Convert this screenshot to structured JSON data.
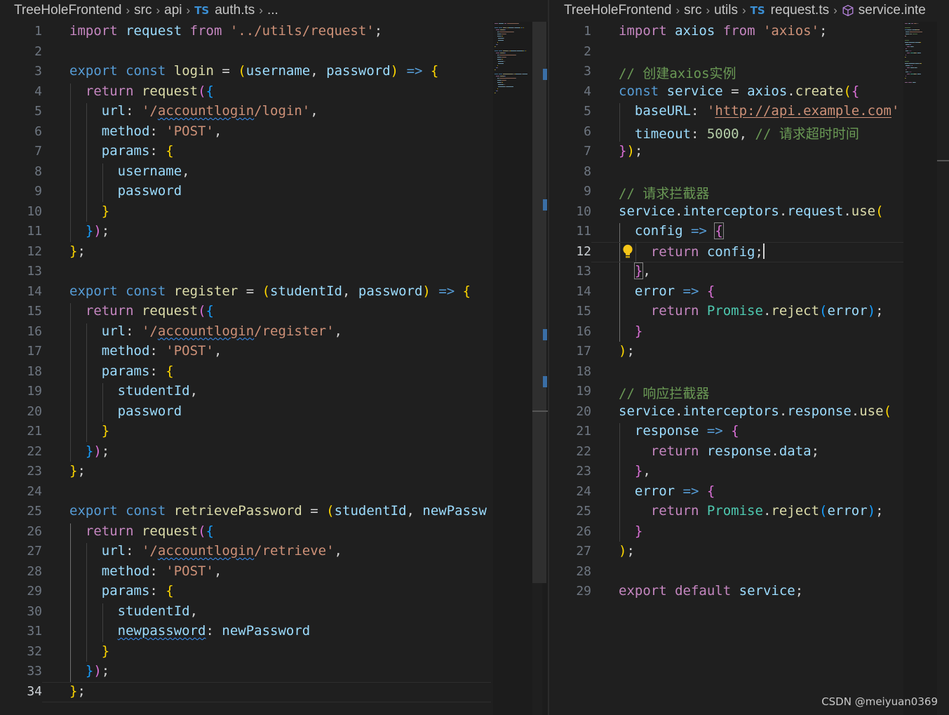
{
  "left_editor": {
    "breadcrumb": [
      "TreeHoleFrontend",
      "src",
      "api",
      "auth.ts",
      "..."
    ],
    "file_type_badge": "TS",
    "current_line": 34,
    "lines": [
      [
        [
          "kc",
          "import"
        ],
        [
          "op",
          " "
        ],
        [
          "vr",
          "request"
        ],
        [
          "op",
          " "
        ],
        [
          "kc",
          "from"
        ],
        [
          "op",
          " "
        ],
        [
          "st",
          "'../utils/request'"
        ],
        [
          "op",
          ";"
        ]
      ],
      [],
      [
        [
          "kw",
          "export"
        ],
        [
          "op",
          " "
        ],
        [
          "kw",
          "const"
        ],
        [
          "op",
          " "
        ],
        [
          "fn",
          "login"
        ],
        [
          "op",
          " = "
        ],
        [
          "b1",
          "("
        ],
        [
          "vr",
          "username"
        ],
        [
          "op",
          ", "
        ],
        [
          "vr",
          "password"
        ],
        [
          "b1",
          ")"
        ],
        [
          "op",
          " "
        ],
        [
          "kw",
          "=>"
        ],
        [
          "op",
          " "
        ],
        [
          "b1",
          "{"
        ]
      ],
      [
        [
          "op",
          "  "
        ],
        [
          "kc",
          "return"
        ],
        [
          "op",
          " "
        ],
        [
          "fn",
          "request"
        ],
        [
          "b2",
          "("
        ],
        [
          "b3",
          "{"
        ]
      ],
      [
        [
          "op",
          "    "
        ],
        [
          "vr",
          "url"
        ],
        [
          "op",
          ": "
        ],
        [
          "st",
          "'/"
        ],
        [
          "st squig",
          "accountlogin"
        ],
        [
          "st",
          "/login'"
        ],
        [
          "op",
          ","
        ]
      ],
      [
        [
          "op",
          "    "
        ],
        [
          "vr",
          "method"
        ],
        [
          "op",
          ": "
        ],
        [
          "st",
          "'POST'"
        ],
        [
          "op",
          ","
        ]
      ],
      [
        [
          "op",
          "    "
        ],
        [
          "vr",
          "params"
        ],
        [
          "op",
          ": "
        ],
        [
          "b1",
          "{"
        ]
      ],
      [
        [
          "op",
          "      "
        ],
        [
          "vr",
          "username"
        ],
        [
          "op",
          ","
        ]
      ],
      [
        [
          "op",
          "      "
        ],
        [
          "vr",
          "password"
        ]
      ],
      [
        [
          "op",
          "    "
        ],
        [
          "b1",
          "}"
        ]
      ],
      [
        [
          "op",
          "  "
        ],
        [
          "b3",
          "}"
        ],
        [
          "b2",
          ")"
        ],
        [
          "op",
          ";"
        ]
      ],
      [
        [
          "b1",
          "}"
        ],
        [
          "op",
          ";"
        ]
      ],
      [],
      [
        [
          "kw",
          "export"
        ],
        [
          "op",
          " "
        ],
        [
          "kw",
          "const"
        ],
        [
          "op",
          " "
        ],
        [
          "fn",
          "register"
        ],
        [
          "op",
          " = "
        ],
        [
          "b1",
          "("
        ],
        [
          "vr",
          "studentId"
        ],
        [
          "op",
          ", "
        ],
        [
          "vr",
          "password"
        ],
        [
          "b1",
          ")"
        ],
        [
          "op",
          " "
        ],
        [
          "kw",
          "=>"
        ],
        [
          "op",
          " "
        ],
        [
          "b1",
          "{"
        ]
      ],
      [
        [
          "op",
          "  "
        ],
        [
          "kc",
          "return"
        ],
        [
          "op",
          " "
        ],
        [
          "fn",
          "request"
        ],
        [
          "b2",
          "("
        ],
        [
          "b3",
          "{"
        ]
      ],
      [
        [
          "op",
          "    "
        ],
        [
          "vr",
          "url"
        ],
        [
          "op",
          ": "
        ],
        [
          "st",
          "'/"
        ],
        [
          "st squig",
          "accountlogin"
        ],
        [
          "st",
          "/register'"
        ],
        [
          "op",
          ","
        ]
      ],
      [
        [
          "op",
          "    "
        ],
        [
          "vr",
          "method"
        ],
        [
          "op",
          ": "
        ],
        [
          "st",
          "'POST'"
        ],
        [
          "op",
          ","
        ]
      ],
      [
        [
          "op",
          "    "
        ],
        [
          "vr",
          "params"
        ],
        [
          "op",
          ": "
        ],
        [
          "b1",
          "{"
        ]
      ],
      [
        [
          "op",
          "      "
        ],
        [
          "vr",
          "studentId"
        ],
        [
          "op",
          ","
        ]
      ],
      [
        [
          "op",
          "      "
        ],
        [
          "vr",
          "password"
        ]
      ],
      [
        [
          "op",
          "    "
        ],
        [
          "b1",
          "}"
        ]
      ],
      [
        [
          "op",
          "  "
        ],
        [
          "b3",
          "}"
        ],
        [
          "b2",
          ")"
        ],
        [
          "op",
          ";"
        ]
      ],
      [
        [
          "b1",
          "}"
        ],
        [
          "op",
          ";"
        ]
      ],
      [],
      [
        [
          "kw",
          "export"
        ],
        [
          "op",
          " "
        ],
        [
          "kw",
          "const"
        ],
        [
          "op",
          " "
        ],
        [
          "fn",
          "retrievePassword"
        ],
        [
          "op",
          " = "
        ],
        [
          "b1",
          "("
        ],
        [
          "vr",
          "studentId"
        ],
        [
          "op",
          ", "
        ],
        [
          "vr",
          "newPassw"
        ]
      ],
      [
        [
          "op",
          "  "
        ],
        [
          "kc",
          "return"
        ],
        [
          "op",
          " "
        ],
        [
          "fn",
          "request"
        ],
        [
          "b2",
          "("
        ],
        [
          "b3",
          "{"
        ]
      ],
      [
        [
          "op",
          "    "
        ],
        [
          "vr",
          "url"
        ],
        [
          "op",
          ": "
        ],
        [
          "st",
          "'/"
        ],
        [
          "st squig",
          "accountlogin"
        ],
        [
          "st",
          "/retrieve'"
        ],
        [
          "op",
          ","
        ]
      ],
      [
        [
          "op",
          "    "
        ],
        [
          "vr",
          "method"
        ],
        [
          "op",
          ": "
        ],
        [
          "st",
          "'POST'"
        ],
        [
          "op",
          ","
        ]
      ],
      [
        [
          "op",
          "    "
        ],
        [
          "vr",
          "params"
        ],
        [
          "op",
          ": "
        ],
        [
          "b1",
          "{"
        ]
      ],
      [
        [
          "op",
          "      "
        ],
        [
          "vr",
          "studentId"
        ],
        [
          "op",
          ","
        ]
      ],
      [
        [
          "op",
          "      "
        ],
        [
          "vr squig",
          "newpassword"
        ],
        [
          "op",
          ": "
        ],
        [
          "vr",
          "newPassword"
        ]
      ],
      [
        [
          "op",
          "    "
        ],
        [
          "b1",
          "}"
        ]
      ],
      [
        [
          "op",
          "  "
        ],
        [
          "b3",
          "}"
        ],
        [
          "b2",
          ")"
        ],
        [
          "op",
          ";"
        ]
      ],
      [
        [
          "b1",
          "}"
        ],
        [
          "op",
          ";"
        ]
      ]
    ]
  },
  "right_editor": {
    "breadcrumb": [
      "TreeHoleFrontend",
      "src",
      "utils",
      "request.ts",
      "service.inte"
    ],
    "file_type_badge": "TS",
    "current_line": 12,
    "lines": [
      [
        [
          "kc",
          "import"
        ],
        [
          "op",
          " "
        ],
        [
          "vr",
          "axios"
        ],
        [
          "op",
          " "
        ],
        [
          "kc",
          "from"
        ],
        [
          "op",
          " "
        ],
        [
          "st",
          "'axios'"
        ],
        [
          "op",
          ";"
        ]
      ],
      [],
      [
        [
          "cm",
          "// 创建axios实例"
        ]
      ],
      [
        [
          "kw",
          "const"
        ],
        [
          "op",
          " "
        ],
        [
          "vr",
          "service"
        ],
        [
          "op",
          " = "
        ],
        [
          "vr",
          "axios"
        ],
        [
          "op",
          "."
        ],
        [
          "fn",
          "create"
        ],
        [
          "b1",
          "("
        ],
        [
          "b2",
          "{"
        ]
      ],
      [
        [
          "op",
          "  "
        ],
        [
          "vr",
          "baseURL"
        ],
        [
          "op",
          ": "
        ],
        [
          "st",
          "'"
        ],
        [
          "st link",
          "http://api.example.com"
        ],
        [
          "st",
          "'"
        ]
      ],
      [
        [
          "op",
          "  "
        ],
        [
          "vr",
          "timeout"
        ],
        [
          "op",
          ": "
        ],
        [
          "nm",
          "5000"
        ],
        [
          "op",
          ", "
        ],
        [
          "cm",
          "// 请求超时时间"
        ]
      ],
      [
        [
          "b2",
          "}"
        ],
        [
          "b1",
          ")"
        ],
        [
          "op",
          ";"
        ]
      ],
      [],
      [
        [
          "cm",
          "// 请求拦截器"
        ]
      ],
      [
        [
          "vr",
          "service"
        ],
        [
          "op",
          "."
        ],
        [
          "vr",
          "interceptors"
        ],
        [
          "op",
          "."
        ],
        [
          "vr",
          "request"
        ],
        [
          "op",
          "."
        ],
        [
          "fn",
          "use"
        ],
        [
          "b1",
          "("
        ]
      ],
      [
        [
          "op",
          "  "
        ],
        [
          "vr",
          "config"
        ],
        [
          "op",
          " "
        ],
        [
          "kw",
          "=>"
        ],
        [
          "op",
          " "
        ],
        [
          "b2 bracket-box",
          "{"
        ]
      ],
      [
        [
          "op",
          "    "
        ],
        [
          "kc",
          "return"
        ],
        [
          "op",
          " "
        ],
        [
          "vr",
          "config"
        ],
        [
          "op",
          ";"
        ],
        [
          "cursor",
          ""
        ]
      ],
      [
        [
          "op",
          "  "
        ],
        [
          "b2 bracket-box",
          "}"
        ],
        [
          "op",
          ","
        ]
      ],
      [
        [
          "op",
          "  "
        ],
        [
          "vr",
          "error"
        ],
        [
          "op",
          " "
        ],
        [
          "kw",
          "=>"
        ],
        [
          "op",
          " "
        ],
        [
          "b2",
          "{"
        ]
      ],
      [
        [
          "op",
          "    "
        ],
        [
          "kc",
          "return"
        ],
        [
          "op",
          " "
        ],
        [
          "cl",
          "Promise"
        ],
        [
          "op",
          "."
        ],
        [
          "fn",
          "reject"
        ],
        [
          "b3",
          "("
        ],
        [
          "vr",
          "error"
        ],
        [
          "b3",
          ")"
        ],
        [
          "op",
          ";"
        ]
      ],
      [
        [
          "op",
          "  "
        ],
        [
          "b2",
          "}"
        ]
      ],
      [
        [
          "b1",
          ")"
        ],
        [
          "op",
          ";"
        ]
      ],
      [],
      [
        [
          "cm",
          "// 响应拦截器"
        ]
      ],
      [
        [
          "vr",
          "service"
        ],
        [
          "op",
          "."
        ],
        [
          "vr",
          "interceptors"
        ],
        [
          "op",
          "."
        ],
        [
          "vr",
          "response"
        ],
        [
          "op",
          "."
        ],
        [
          "fn",
          "use"
        ],
        [
          "b1",
          "("
        ]
      ],
      [
        [
          "op",
          "  "
        ],
        [
          "vr",
          "response"
        ],
        [
          "op",
          " "
        ],
        [
          "kw",
          "=>"
        ],
        [
          "op",
          " "
        ],
        [
          "b2",
          "{"
        ]
      ],
      [
        [
          "op",
          "    "
        ],
        [
          "kc",
          "return"
        ],
        [
          "op",
          " "
        ],
        [
          "vr",
          "response"
        ],
        [
          "op",
          "."
        ],
        [
          "vr",
          "data"
        ],
        [
          "op",
          ";"
        ]
      ],
      [
        [
          "op",
          "  "
        ],
        [
          "b2",
          "}"
        ],
        [
          "op",
          ","
        ]
      ],
      [
        [
          "op",
          "  "
        ],
        [
          "vr",
          "error"
        ],
        [
          "op",
          " "
        ],
        [
          "kw",
          "=>"
        ],
        [
          "op",
          " "
        ],
        [
          "b2",
          "{"
        ]
      ],
      [
        [
          "op",
          "    "
        ],
        [
          "kc",
          "return"
        ],
        [
          "op",
          " "
        ],
        [
          "cl",
          "Promise"
        ],
        [
          "op",
          "."
        ],
        [
          "fn",
          "reject"
        ],
        [
          "b3",
          "("
        ],
        [
          "vr",
          "error"
        ],
        [
          "b3",
          ")"
        ],
        [
          "op",
          ";"
        ]
      ],
      [
        [
          "op",
          "  "
        ],
        [
          "b2",
          "}"
        ]
      ],
      [
        [
          "b1",
          ")"
        ],
        [
          "op",
          ";"
        ]
      ],
      [],
      [
        [
          "kc",
          "export"
        ],
        [
          "op",
          " "
        ],
        [
          "kc",
          "default"
        ],
        [
          "op",
          " "
        ],
        [
          "vr",
          "service"
        ],
        [
          "op",
          ";"
        ]
      ]
    ]
  },
  "watermark": "CSDN @meiyuan0369"
}
